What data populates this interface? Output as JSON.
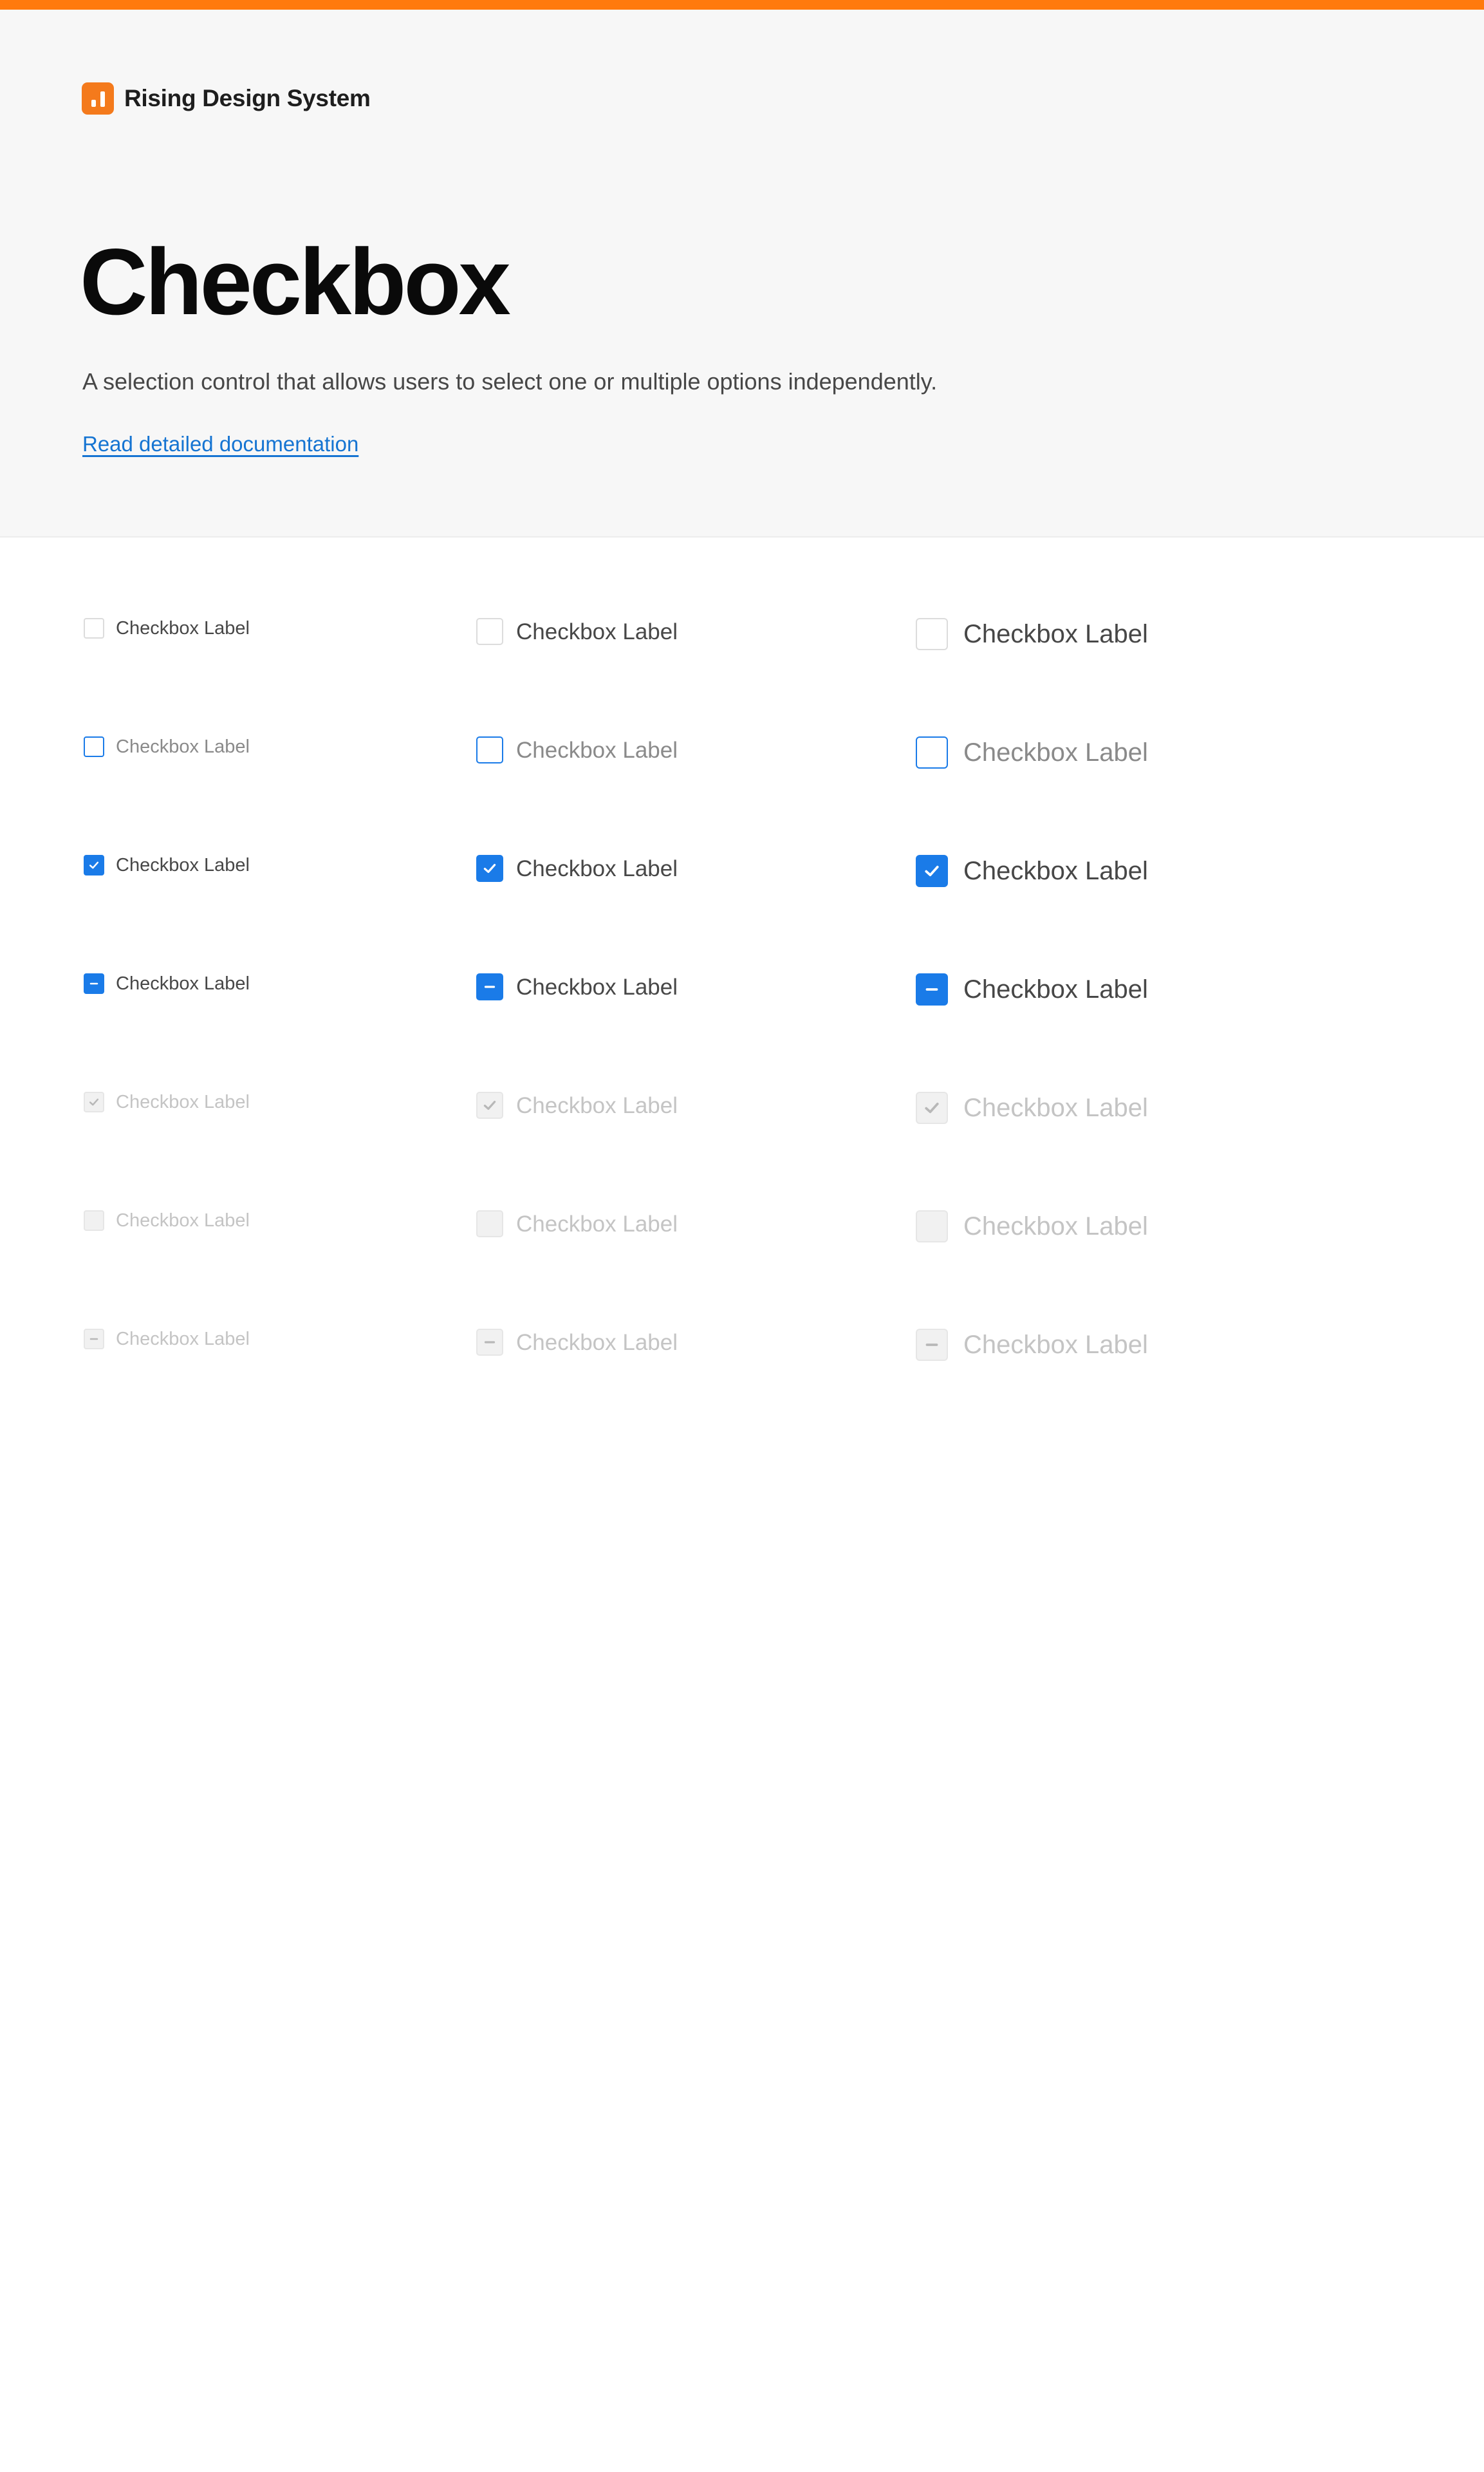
{
  "colors": {
    "accent_top": "#ff7a0d",
    "brand_logo": "#f47a1c",
    "primary": "#1a7be8",
    "link": "#1574d2",
    "label": "#474747",
    "label_focus": "#8a8a8a",
    "label_disabled": "#c4c4c4",
    "border_default": "#dcdcdc",
    "disabled_fill": "#f1f1f1",
    "disabled_border": "#e6e6e6",
    "disabled_mark": "#b8b8b8"
  },
  "brand": {
    "logo_icon": "bar-chart-logo-icon",
    "name": "Rising Design System"
  },
  "hero": {
    "title": "Checkbox",
    "description": "A selection control that allows users to select one or multiple options independently.",
    "doc_link": "Read detailed documentation"
  },
  "sizes": [
    "sm",
    "md",
    "lg"
  ],
  "rows": [
    {
      "state": "default",
      "label": "Checkbox Label",
      "icon": "empty-checkbox-icon"
    },
    {
      "state": "focused",
      "label": "Checkbox Label",
      "icon": "focused-checkbox-icon"
    },
    {
      "state": "checked",
      "label": "Checkbox Label",
      "icon": "checkmark-icon"
    },
    {
      "state": "indeterminate",
      "label": "Checkbox Label",
      "icon": "minus-icon"
    },
    {
      "state": "disabled-checked",
      "label": "Checkbox Label",
      "icon": "checkmark-icon"
    },
    {
      "state": "disabled",
      "label": "Checkbox Label",
      "icon": "empty-checkbox-icon"
    },
    {
      "state": "disabled-indeterminate",
      "label": "Checkbox Label",
      "icon": "minus-icon"
    }
  ]
}
